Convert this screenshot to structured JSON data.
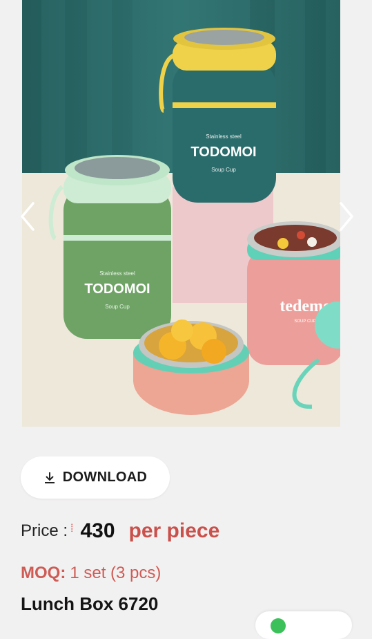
{
  "product_image": {
    "brand_text": "TODOMOI",
    "tag_top": "Stainless steel",
    "tag_bottom": "Soup Cup",
    "alt_brand": "tedeme",
    "alt_tag": "SOUP CUP"
  },
  "download": {
    "label": "DOWNLOAD"
  },
  "price": {
    "label": "Price :",
    "value": "430",
    "unit": "per piece"
  },
  "moq": {
    "label": "MOQ:",
    "value": "1 set (3 pcs)"
  },
  "product": {
    "name": "Lunch Box 6720"
  },
  "colors": {
    "accent_red": "#c9504b",
    "curtain": "#2a6b6a",
    "whatsapp_green": "#3cc15a"
  }
}
